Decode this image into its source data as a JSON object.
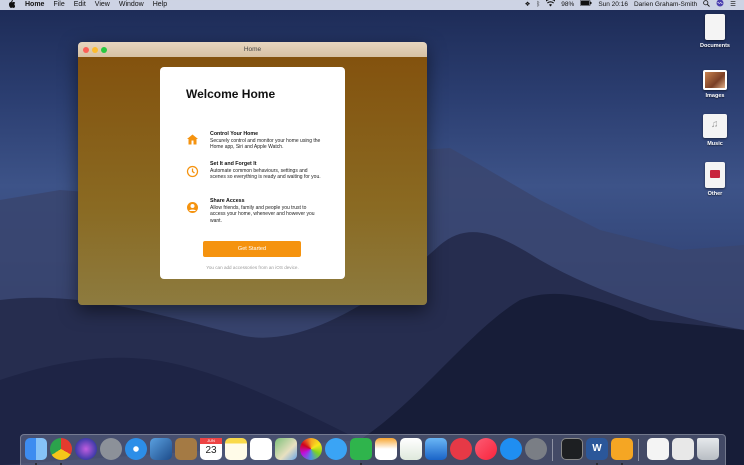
{
  "menubar": {
    "apple": "",
    "app_name": "Home",
    "items": [
      "File",
      "Edit",
      "View",
      "Window",
      "Help"
    ],
    "battery": "98%",
    "clock": "Sun 20:16",
    "user": "Darien Graham-Smith"
  },
  "desktop": {
    "icons": [
      {
        "label": "Documents",
        "icon": "documents-icon"
      },
      {
        "label": "Images",
        "icon": "images-icon"
      },
      {
        "label": "Music",
        "icon": "music-icon"
      },
      {
        "label": "Other",
        "icon": "other-icon"
      }
    ]
  },
  "window": {
    "title": "Home",
    "card": {
      "heading": "Welcome Home",
      "features": [
        {
          "title": "Control Your Home",
          "desc": "Securely control and monitor your home using the Home app, Siri and Apple Watch.",
          "icon": "house-icon"
        },
        {
          "title": "Set It and Forget It",
          "desc": "Automate common behaviours, settings and scenes so everything is ready and waiting for you.",
          "icon": "clock-icon"
        },
        {
          "title": "Share Access",
          "desc": "Allow friends, family and people you trust to access your home, whenever and however you want.",
          "icon": "person-icon"
        }
      ],
      "button": "Get Started",
      "footnote": "You can add accessories from an iOS device."
    }
  },
  "dock": {
    "apps": [
      "Finder",
      "Chrome",
      "Siri",
      "Launchpad",
      "Safari",
      "Preview",
      "Notebook",
      "Calendar",
      "Notes",
      "Reminders",
      "Maps",
      "Photos",
      "Messages",
      "FaceTime",
      "Pages",
      "Numbers",
      "Keynote",
      "News",
      "Music",
      "App Store",
      "System Preferences",
      "Activity Monitor",
      "Word",
      "Home",
      "Document",
      "Mail",
      "Trash"
    ],
    "calendar_month": "JUN",
    "calendar_day": "23"
  },
  "colors": {
    "accent": "#f5930f",
    "window_bg": "#83520e"
  }
}
